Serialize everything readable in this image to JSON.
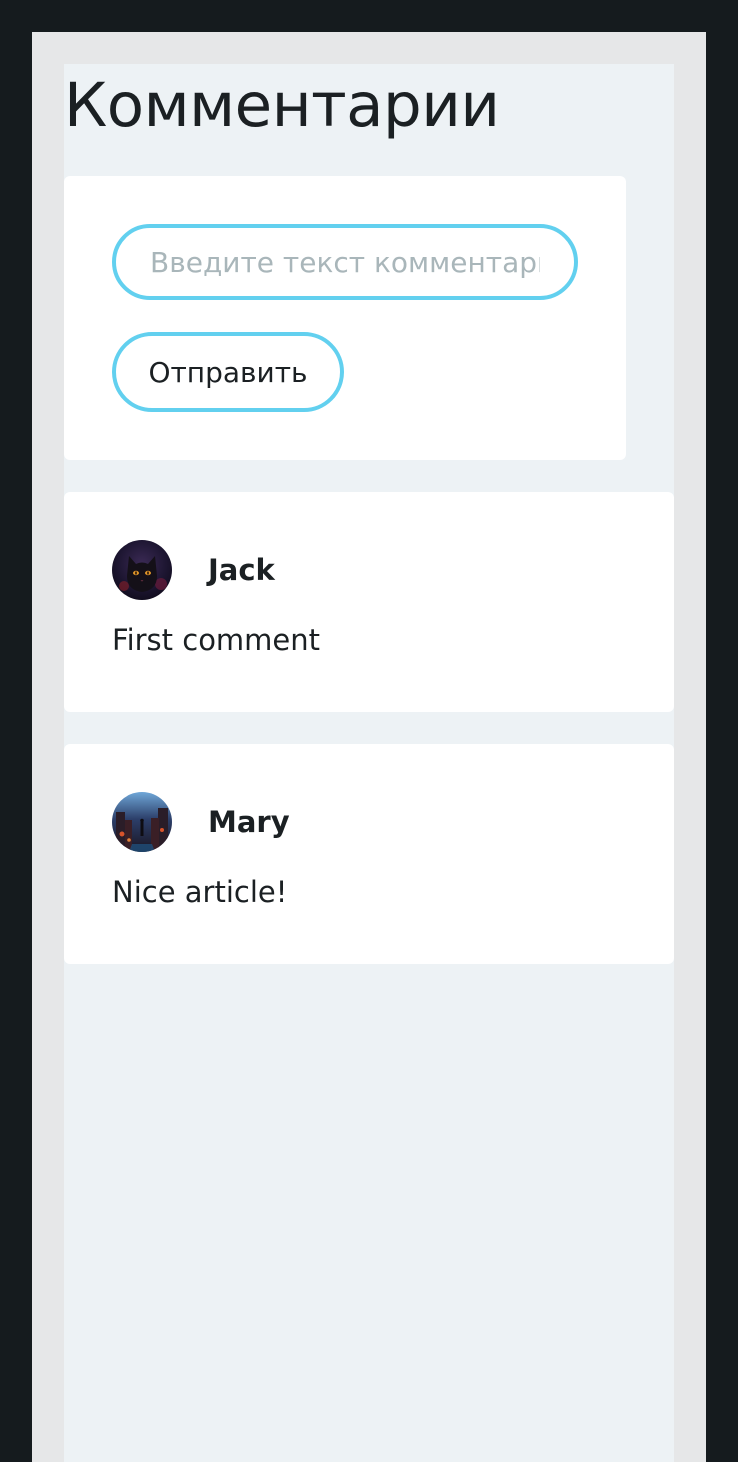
{
  "page": {
    "title": "Комментарии"
  },
  "comment_form": {
    "input_placeholder": "Введите текст комментария",
    "input_value": "",
    "submit_label": "Отправить"
  },
  "comments": [
    {
      "author": "Jack",
      "text": "First comment",
      "avatar_icon": "black-cat-avatar"
    },
    {
      "author": "Mary",
      "text": "Nice article!",
      "avatar_icon": "night-city-avatar"
    }
  ],
  "colors": {
    "accent": "#62d0ef",
    "page_background": "#edf2f5",
    "outer_background": "#151b1e",
    "card_background": "#ffffff",
    "text": "#1b2023",
    "placeholder": "#a9b6ba"
  }
}
